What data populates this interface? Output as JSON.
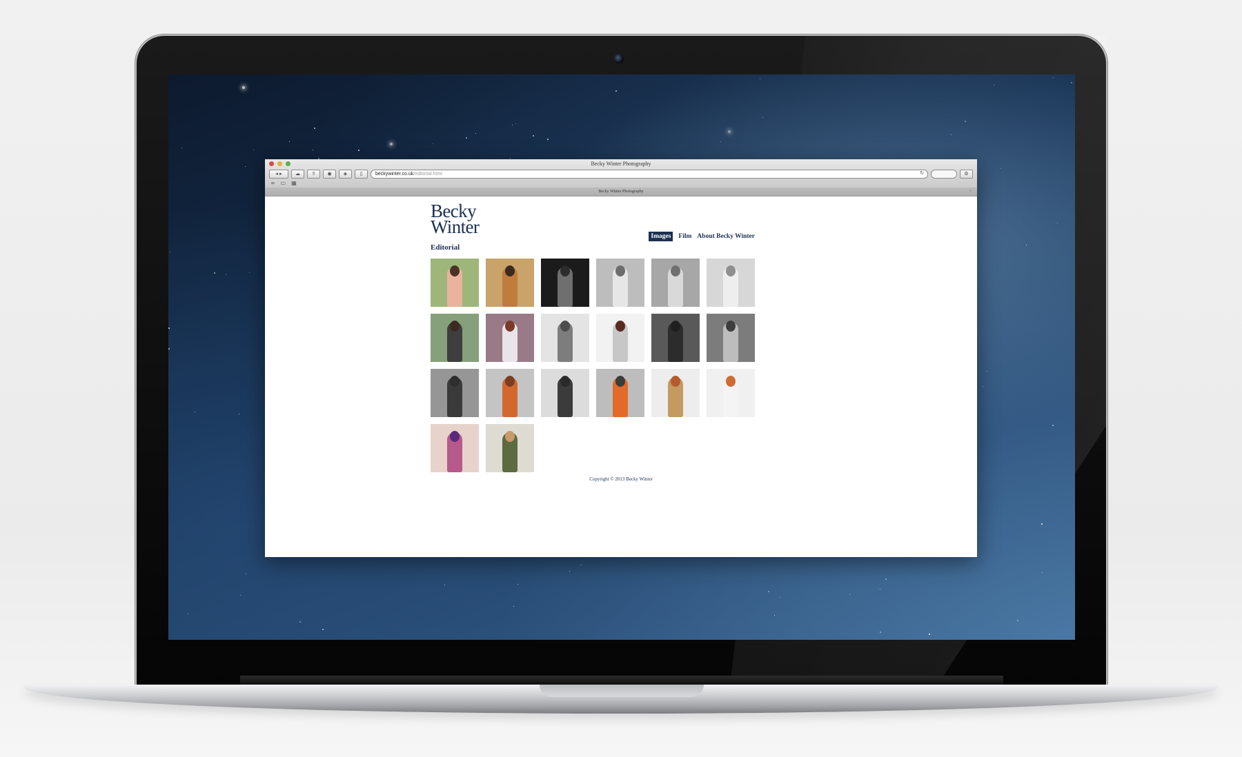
{
  "window": {
    "title": "Becky Winter Photography",
    "tab_title": "Becky Winter Photography"
  },
  "address_bar": {
    "domain": "beckywinter.co.uk",
    "path": "/editorial.html"
  },
  "site": {
    "logo_line1": "Becky",
    "logo_line2": "Winter",
    "nav": [
      {
        "label": "Images",
        "active": true
      },
      {
        "label": "Film",
        "active": false
      },
      {
        "label": "About Becky Winter",
        "active": false
      }
    ],
    "section_title": "Editorial",
    "gallery": [
      {
        "bg": "#9fb67a",
        "fig": "#e9b39d",
        "head": "#4a3325"
      },
      {
        "bg": "#c9a36a",
        "fig": "#c07c3c",
        "head": "#3a2a20"
      },
      {
        "bg": "#1b1b1b",
        "fig": "#6f6f6f",
        "head": "#2c2c2c"
      },
      {
        "bg": "#bdbdbd",
        "fig": "#e6e6e6",
        "head": "#6d6d6d"
      },
      {
        "bg": "#a7a7a7",
        "fig": "#d9d9d9",
        "head": "#707070"
      },
      {
        "bg": "#d7d7d7",
        "fig": "#eeeeee",
        "head": "#8f8f8f"
      },
      {
        "bg": "#85a07a",
        "fig": "#3e3e3e",
        "head": "#3b2a20"
      },
      {
        "bg": "#9a7a86",
        "fig": "#e8e4ea",
        "head": "#7a3a2a"
      },
      {
        "bg": "#e4e4e4",
        "fig": "#7d7d7d",
        "head": "#4d4d4d"
      },
      {
        "bg": "#f2f2f2",
        "fig": "#c7c7c7",
        "head": "#5a2a22"
      },
      {
        "bg": "#595959",
        "fig": "#2c2c2c",
        "head": "#1f1f1f"
      },
      {
        "bg": "#7c7c7c",
        "fig": "#bdbdbd",
        "head": "#3d3d3d"
      },
      {
        "bg": "#969696",
        "fig": "#3a3a3a",
        "head": "#2e2e2e"
      },
      {
        "bg": "#c4c4c4",
        "fig": "#d2682e",
        "head": "#7a3f22"
      },
      {
        "bg": "#dcdcdc",
        "fig": "#3b3b3b",
        "head": "#2a2a2a"
      },
      {
        "bg": "#bdbdbd",
        "fig": "#e26a2a",
        "head": "#3c3c3c"
      },
      {
        "bg": "#ededed",
        "fig": "#c49a5e",
        "head": "#b65a2e"
      },
      {
        "bg": "#f0f0f0",
        "fig": "#f4f4f4",
        "head": "#d06a34"
      },
      {
        "bg": "#e8d2cc",
        "fig": "#b55a8a",
        "head": "#5a2a7a"
      },
      {
        "bg": "#dedcd2",
        "fig": "#5c6b40",
        "head": "#c99a6a"
      }
    ],
    "footer": "Copyright © 2013  Becky Winter"
  },
  "colors": {
    "brand_navy": "#1c2f52",
    "desktop_blue": "#16304f"
  }
}
